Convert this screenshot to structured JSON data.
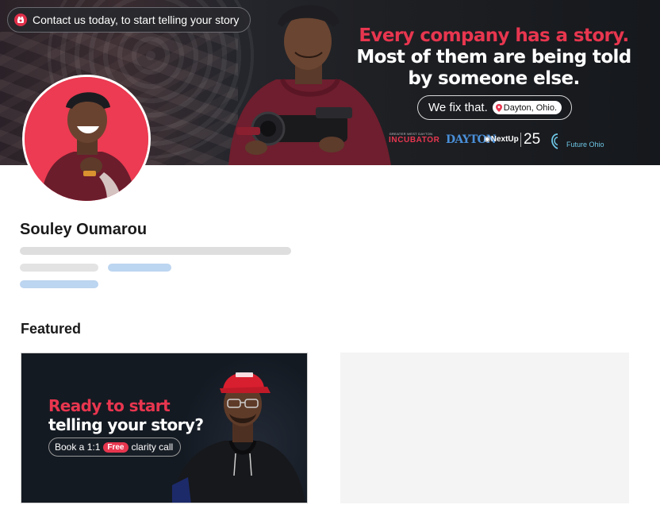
{
  "banner": {
    "contact_text": "Contact us today, to start telling your story",
    "headline_line1": "Every company has a story.",
    "headline_line2": "Most of them are being told",
    "headline_line3": "by someone else.",
    "fix_text": "We fix that.",
    "location": "Dayton, Ohio.",
    "logos": {
      "incubator_small": "GREATER WEST DAYTON",
      "incubator_big": "INCUBATOR",
      "dayton": "DAYTON",
      "nextup": "NextUp",
      "nextup_number": "25",
      "future_ohio": "Future Ohio"
    },
    "colors": {
      "accent": "#e8364f",
      "background": "#15181c",
      "chip": "#ffffff"
    }
  },
  "profile": {
    "name": "Souley Oumarou",
    "avatar_color": "#ec3b52"
  },
  "featured": {
    "title": "Featured",
    "card": {
      "heading_line1": "Ready to start",
      "heading_line2": "telling your story?",
      "cta_prefix": "Book a 1:1",
      "cta_badge": "Free",
      "cta_suffix": "clarity call"
    }
  }
}
